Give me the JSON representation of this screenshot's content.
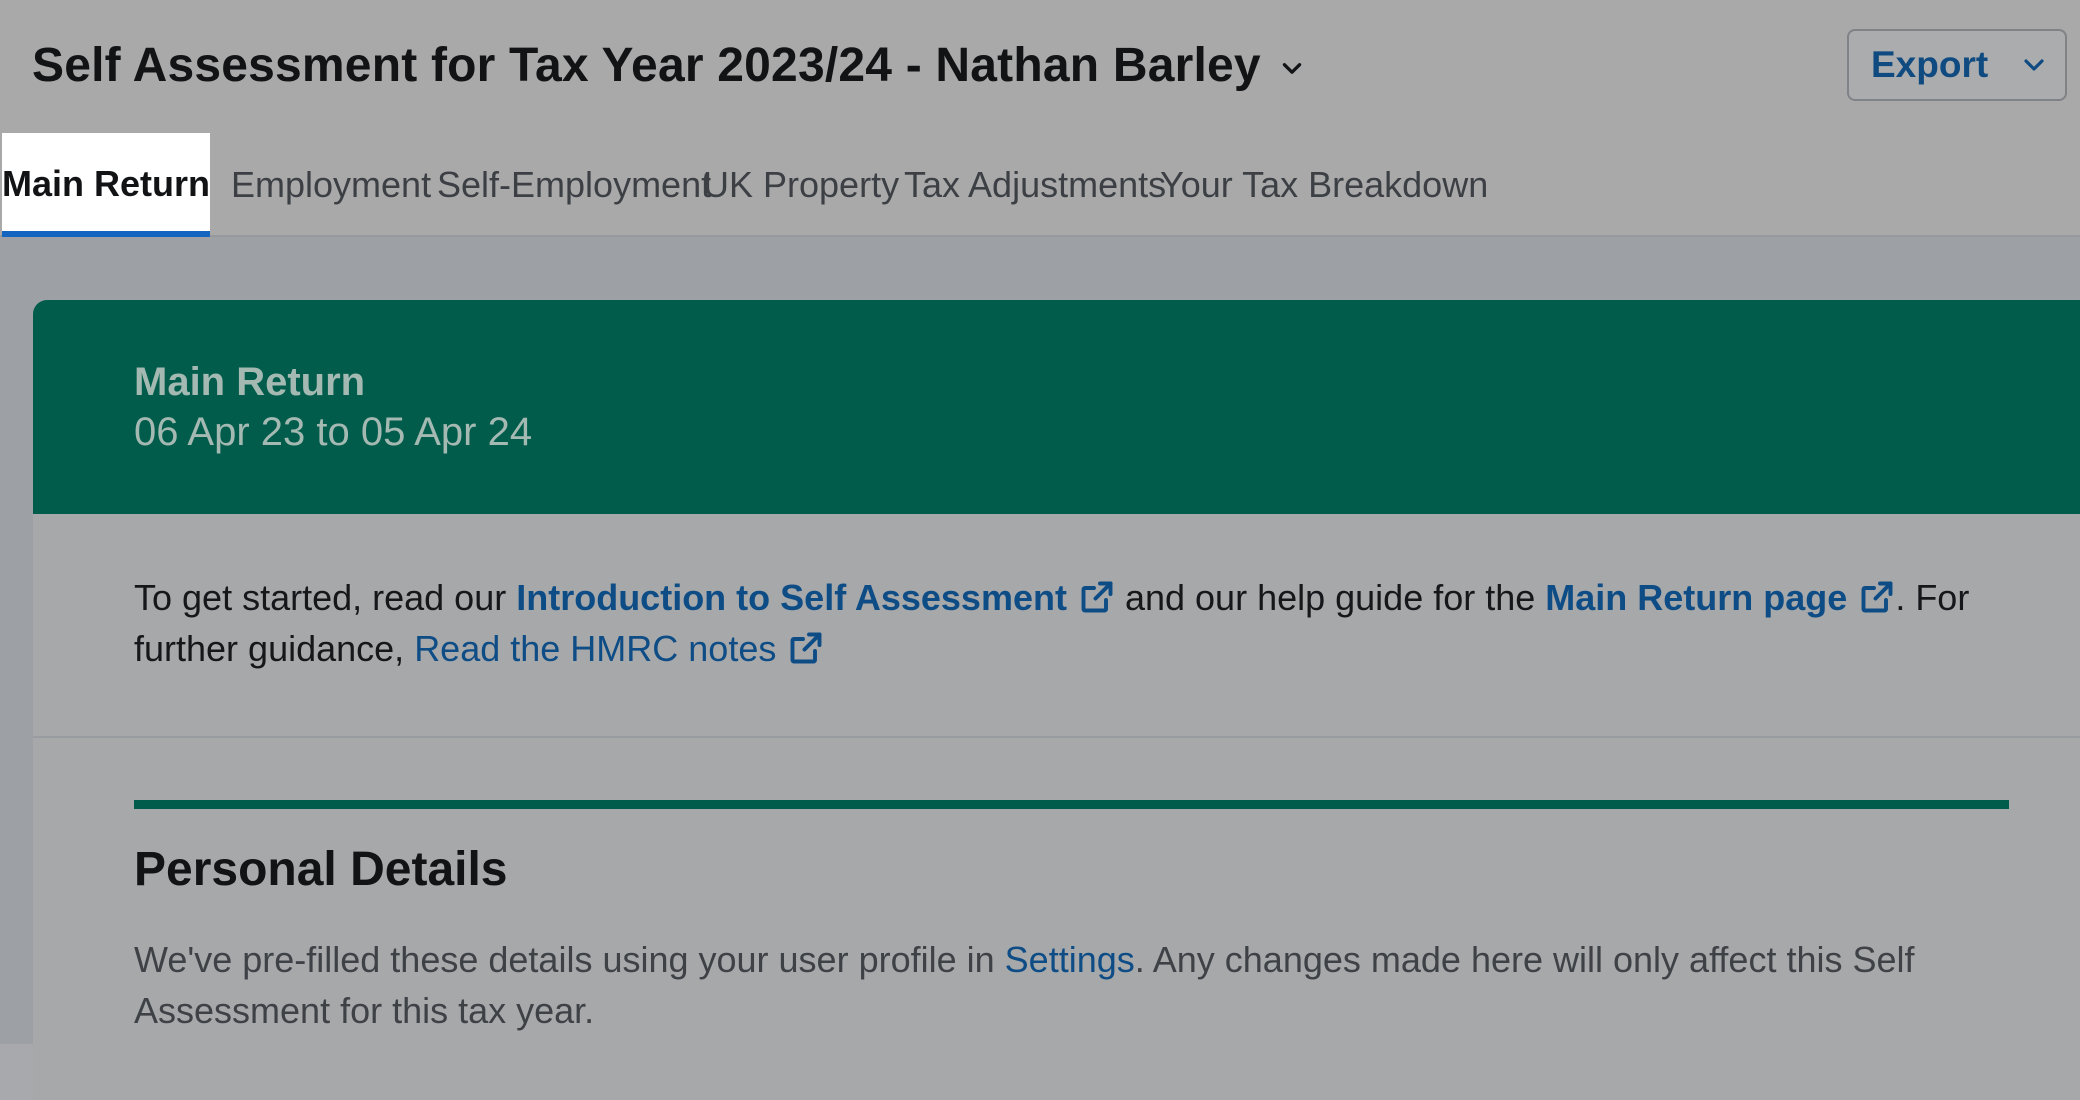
{
  "header": {
    "title": "Self Assessment for Tax Year 2023/24 - Nathan Barley",
    "title_dropdown_icon": "chevron-down-icon",
    "export_label": "Export",
    "export_dropdown_icon": "chevron-down-icon"
  },
  "tabs": [
    {
      "label": "Main Return",
      "active": true
    },
    {
      "label": "Employment",
      "active": false
    },
    {
      "label": "Self-Employment",
      "active": false
    },
    {
      "label": "UK Property",
      "active": false
    },
    {
      "label": "Tax Adjustments",
      "active": false
    },
    {
      "label": "Your Tax Breakdown",
      "active": false
    }
  ],
  "banner": {
    "title": "Main Return",
    "dates": "06 Apr 23 to 05 Apr 24"
  },
  "intro": {
    "prefix": "To get started, read our ",
    "link1": "Introduction to Self Assessment",
    "middle": " and our help guide for the ",
    "link2": "Main Return page",
    "after_link2": ". For further guidance, ",
    "link3": "Read the HMRC notes",
    "external_icon": "external-link-icon"
  },
  "personal_details": {
    "title": "Personal Details",
    "desc_prefix": "We've pre-filled these details using your user profile in ",
    "settings_link": "Settings",
    "desc_suffix": ". Any changes made here will only affect this Self Assessment for this tax year."
  },
  "colors": {
    "brand_green": "#015c4b",
    "link_blue": "#0e4c86",
    "tab_underline": "#1465c0"
  }
}
